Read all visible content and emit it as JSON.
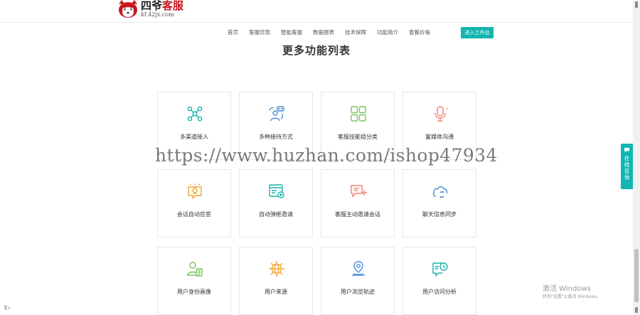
{
  "header": {
    "logo_text_black": "四爷",
    "logo_text_red": "客服",
    "logo_url": "kf.42jx.com",
    "nav_items": [
      "首页",
      "客服优势",
      "智能客服",
      "数据报表",
      "技术保障",
      "功能简介",
      "套餐价格"
    ],
    "cta_label": "进入工作台"
  },
  "section": {
    "title": "更多功能列表"
  },
  "features": [
    {
      "label": "多渠道接入",
      "icon": "multi-channel-icon",
      "color": "#1ab3ad"
    },
    {
      "label": "多种接待方式",
      "icon": "reception-modes-icon",
      "color": "#4a90d9"
    },
    {
      "label": "客服技能组分类",
      "icon": "skill-group-grid-icon",
      "color": "#7ac35a"
    },
    {
      "label": "富媒体沟通",
      "icon": "microphone-icon",
      "color": "#f08070"
    },
    {
      "label": "会话自动应答",
      "icon": "lightbulb-chat-icon",
      "color": "#f2a634"
    },
    {
      "label": "自动弹框邀请",
      "icon": "popup-window-icon",
      "color": "#1ab3ad"
    },
    {
      "label": "客服主动邀请会话",
      "icon": "chat-plus-icon",
      "color": "#f08070"
    },
    {
      "label": "聊天信息同步",
      "icon": "cloud-sync-icon",
      "color": "#4a90d9"
    },
    {
      "label": "用户身份画像",
      "icon": "user-profile-icon",
      "color": "#7ac35a"
    },
    {
      "label": "用户来源",
      "icon": "globe-network-icon",
      "color": "#f2a634"
    },
    {
      "label": "用户浏览轨迹",
      "icon": "location-pin-icon",
      "color": "#4a90d9"
    },
    {
      "label": "用户访问分析",
      "icon": "chat-clock-icon",
      "color": "#1ab3ad"
    }
  ],
  "watermark": "https://www.huzhan.com/ishop47934",
  "float_service": {
    "label": "在线咨询",
    "icon": "chat-bubble-icon"
  },
  "windows_activation": {
    "title": "激活 Windows",
    "subtitle": "转到\"设置\"以激活 Windows。"
  },
  "corner_mark": "I▷",
  "colors": {
    "accent": "#12b5b0",
    "brand_red": "#c8161d",
    "border": "#e6e6e6"
  }
}
